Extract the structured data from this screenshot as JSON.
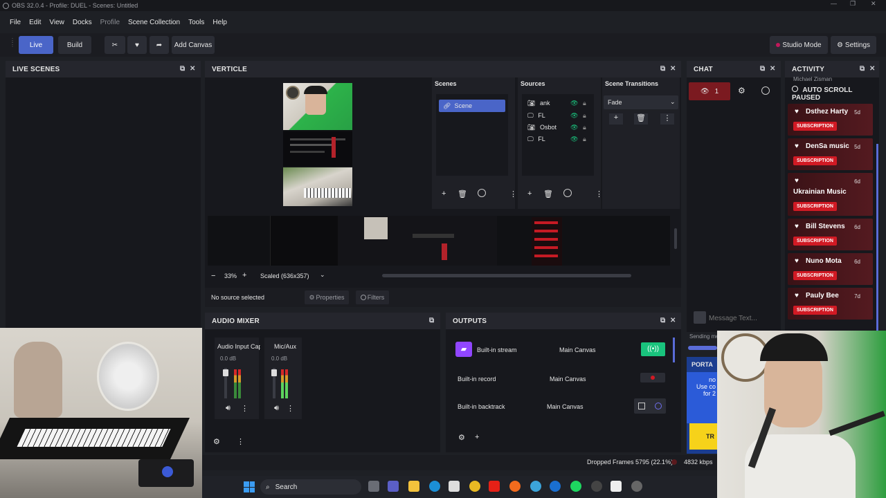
{
  "window": {
    "title": "OBS 32.0.4 - Profile: DUEL - Scenes: Untitled"
  },
  "menu": {
    "items": [
      "File",
      "Edit",
      "View",
      "Docks",
      "Profile",
      "Scene Collection",
      "Tools",
      "Help"
    ]
  },
  "toolbar": {
    "live": "Live",
    "build": "Build",
    "add_canvas": "Add Canvas",
    "studio_mode": "Studio Mode",
    "settings": "Settings"
  },
  "panels": {
    "live_scenes": "LIVE SCENES",
    "verticle": "VERTICLE",
    "chat": "CHAT",
    "activity": "ACTIVITY",
    "audio_mixer": "AUDIO MIXER",
    "outputs": "OUTPUTS"
  },
  "scenes": {
    "header": "Scenes",
    "items": [
      "Scene"
    ]
  },
  "sources": {
    "header": "Sources",
    "items": [
      "ank",
      "FL",
      "Osbot",
      "FL"
    ]
  },
  "transitions": {
    "header": "Scene Transitions",
    "selected": "Fade"
  },
  "preview": {
    "zoom": "33%",
    "scale": "Scaled (636x357)",
    "no_source": "No source selected",
    "properties": "Properties",
    "filters": "Filters"
  },
  "mixer": {
    "channels": [
      {
        "name": "Audio Input Cap",
        "level": "0.0 dB"
      },
      {
        "name": "Mic/Aux",
        "level": "0.0 dB"
      }
    ]
  },
  "outputs": {
    "rows": [
      {
        "name": "Built-in stream",
        "canvas": "Main Canvas"
      },
      {
        "name": "Built-in record",
        "canvas": "Main Canvas"
      },
      {
        "name": "Built-in backtrack",
        "canvas": "Main Canvas"
      }
    ]
  },
  "chat": {
    "viewers": "1",
    "placeholder": "Message Text...",
    "sending": "Sending me"
  },
  "activity": {
    "truncated_top": "Michael Zisman",
    "auto_scroll": "AUTO SCROLL PAUSED",
    "items": [
      {
        "name": "Dsthez Harty",
        "time": "5d",
        "badge": "SUBSCRIPTION"
      },
      {
        "name": "DenSa music",
        "time": "5d",
        "badge": "SUBSCRIPTION"
      },
      {
        "name": "Ukrainian Music",
        "time": "6d",
        "badge": "SUBSCRIPTION"
      },
      {
        "name": "Bill Stevens",
        "time": "6d",
        "badge": "SUBSCRIPTION"
      },
      {
        "name": "Nuno Mota",
        "time": "6d",
        "badge": "SUBSCRIPTION"
      },
      {
        "name": "Pauly Bee",
        "time": "7d",
        "badge": "SUBSCRIPTION"
      }
    ]
  },
  "portal": {
    "title": "PORTA",
    "line1": "no",
    "line2": "Use co",
    "line3": "for 2",
    "button": "TR"
  },
  "status": {
    "dropped": "Dropped Frames 5795 (22.1%)",
    "bitrate": "4832 kbps"
  },
  "taskbar": {
    "search": "Search"
  },
  "colors": {
    "accent": "#4a65c8",
    "live_green": "#19c37d",
    "sub_red": "#d11a24",
    "twitch": "#9146ff"
  }
}
